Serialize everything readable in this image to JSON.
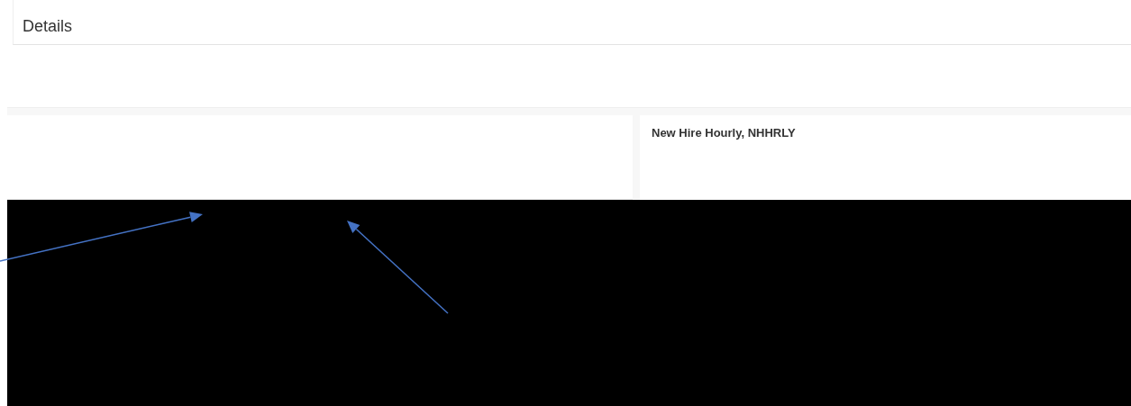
{
  "details_card": {
    "title": "Details"
  },
  "right_card": {
    "title": "New Hire Hourly, NHHRLY"
  },
  "annotations": [
    {
      "kind": "arrow"
    },
    {
      "kind": "arrow"
    }
  ]
}
